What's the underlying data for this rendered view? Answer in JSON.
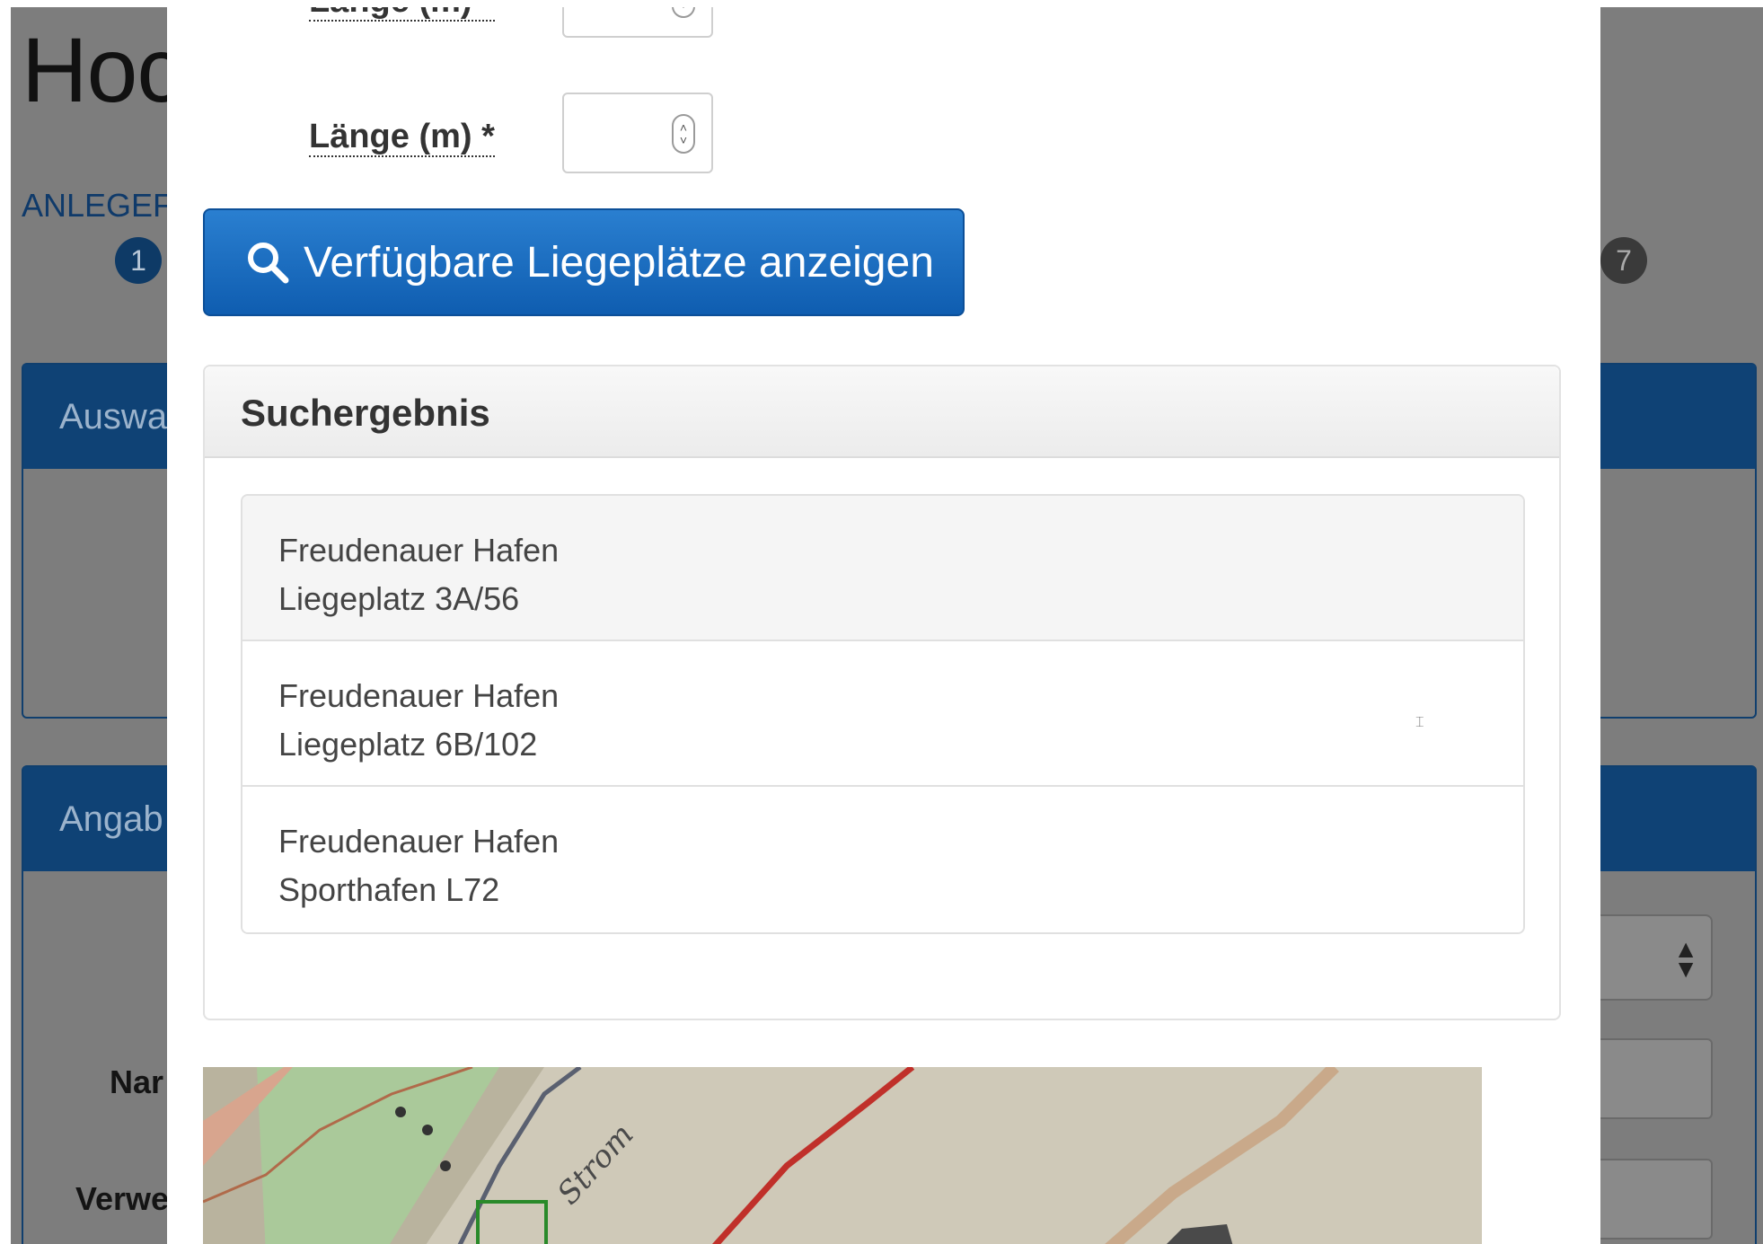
{
  "background": {
    "title": "Hoc",
    "step_label": "ANLEGEF",
    "step_first": "1",
    "step_last": "7",
    "panel_one_title": "Auswa",
    "panel_two_title": "Angab",
    "label_name": "Nar",
    "label_verwendung": "Verwe"
  },
  "modal": {
    "length_label_1": "Länge (m) *",
    "length_label_2": "Länge (m) *",
    "search_button_label": "Verfügbare Liegeplätze anzeigen",
    "results_title": "Suchergebnis",
    "results": [
      {
        "line1": "Freudenauer Hafen",
        "line2": "Liegeplatz 3A/56"
      },
      {
        "line1": "Freudenauer Hafen",
        "line2": "Liegeplatz 6B/102"
      },
      {
        "line1": "Freudenauer Hafen",
        "line2": "Sporthafen L72"
      }
    ],
    "map_annotation": "Strom"
  },
  "colors": {
    "primary_button": "#1a6dc0",
    "overlay_panel_header": "#0f4275"
  },
  "icons": [
    "search-icon",
    "spinner-arrows-icon",
    "select-arrows-icon"
  ]
}
